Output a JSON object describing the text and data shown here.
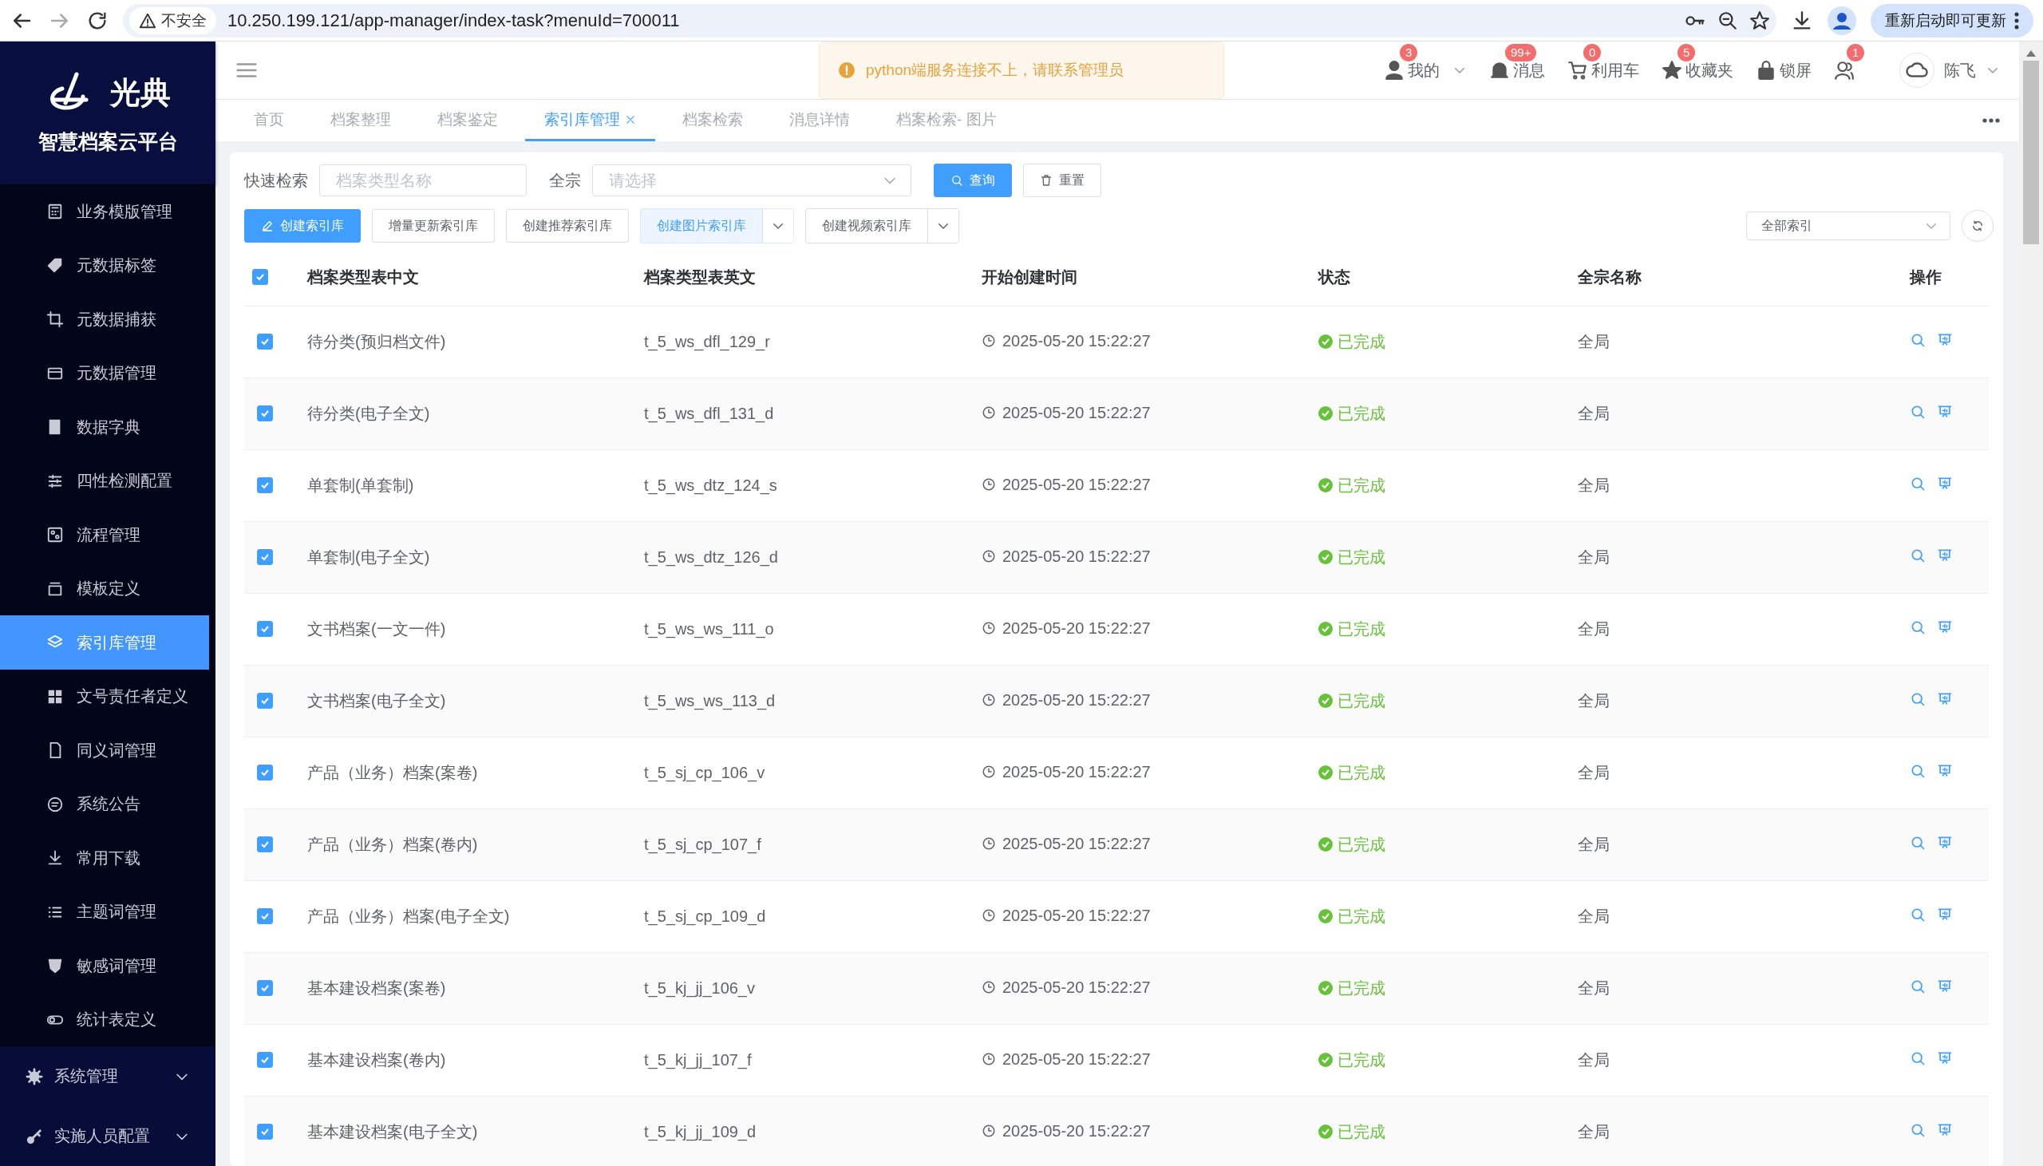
{
  "browser": {
    "security_label": "不安全",
    "url": "10.250.199.121/app-manager/index-task?menuId=700011",
    "update_button": "重新启动即可更新"
  },
  "sidebar": {
    "logo_text": "光典",
    "platform_name": "智慧档案云平台",
    "items": [
      {
        "label": "业务模版管理",
        "selected": false
      },
      {
        "label": "元数据标签",
        "selected": false
      },
      {
        "label": "元数据捕获",
        "selected": false
      },
      {
        "label": "元数据管理",
        "selected": false
      },
      {
        "label": "数据字典",
        "selected": false
      },
      {
        "label": "四性检测配置",
        "selected": false
      },
      {
        "label": "流程管理",
        "selected": false
      },
      {
        "label": "模板定义",
        "selected": false
      },
      {
        "label": "索引库管理",
        "selected": true
      },
      {
        "label": "文号责任者定义",
        "selected": false
      },
      {
        "label": "同义词管理",
        "selected": false
      },
      {
        "label": "系统公告",
        "selected": false
      },
      {
        "label": "常用下载",
        "selected": false
      },
      {
        "label": "主题词管理",
        "selected": false
      },
      {
        "label": "敏感词管理",
        "selected": false
      },
      {
        "label": "统计表定义",
        "selected": false
      }
    ],
    "groups": [
      {
        "label": "系统管理"
      },
      {
        "label": "实施人员配置"
      }
    ]
  },
  "header": {
    "items": [
      {
        "label": "我的",
        "badge": "3",
        "dropdown": true
      },
      {
        "label": "消息",
        "badge": "99+",
        "dropdown": false
      },
      {
        "label": "利用车",
        "badge": "0",
        "dropdown": false
      },
      {
        "label": "收藏夹",
        "badge": "5",
        "dropdown": false
      },
      {
        "label": "锁屏",
        "dropdown": false
      },
      {
        "badge": "1",
        "dropdown": false
      }
    ],
    "user": {
      "name": "陈飞"
    }
  },
  "toast": {
    "text": "python端服务连接不上，请联系管理员"
  },
  "tabs": [
    {
      "label": "首页",
      "selected": false
    },
    {
      "label": "档案整理",
      "selected": false
    },
    {
      "label": "档案鉴定",
      "selected": false
    },
    {
      "label": "索引库管理",
      "selected": true
    },
    {
      "label": "档案检索",
      "selected": false
    },
    {
      "label": "消息详情",
      "selected": false
    },
    {
      "label": "档案检索- 图片",
      "selected": false
    }
  ],
  "search": {
    "label": "快速检索",
    "placeholder": "档案类型名称",
    "fonds_label": "全宗",
    "fonds_placeholder": "请选择",
    "buttons": [
      {
        "label": "查询",
        "kind": "primary"
      },
      {
        "label": "重置",
        "kind": "default"
      }
    ]
  },
  "actions": [
    {
      "label": "创建索引库",
      "kind": "primary"
    },
    {
      "label": "增量更新索引库",
      "kind": "default"
    },
    {
      "label": "创建推荐索引库",
      "kind": "default"
    },
    {
      "label": "创建图片索引库",
      "kind": "split-active"
    },
    {
      "label": "创建视频索引库",
      "kind": "split"
    }
  ],
  "index_filter": {
    "value": "全部索引"
  },
  "table": {
    "all_checked": true,
    "columns": [
      "档案类型表中文",
      "档案类型表英文",
      "开始创建时间",
      "状态",
      "全宗名称",
      "操作"
    ],
    "rows": [
      {
        "checked": true,
        "name": "待分类(预归档文件)",
        "table": "t_5_ws_dfl_129_r",
        "created": "2025-05-20 15:22:27",
        "status": "已完成",
        "fonds": "全局"
      },
      {
        "checked": true,
        "name": "待分类(电子全文)",
        "table": "t_5_ws_dfl_131_d",
        "created": "2025-05-20 15:22:27",
        "status": "已完成",
        "fonds": "全局"
      },
      {
        "checked": true,
        "name": "单套制(单套制)",
        "table": "t_5_ws_dtz_124_s",
        "created": "2025-05-20 15:22:27",
        "status": "已完成",
        "fonds": "全局"
      },
      {
        "checked": true,
        "name": "单套制(电子全文)",
        "table": "t_5_ws_dtz_126_d",
        "created": "2025-05-20 15:22:27",
        "status": "已完成",
        "fonds": "全局"
      },
      {
        "checked": true,
        "name": "文书档案(一文一件)",
        "table": "t_5_ws_ws_111_o",
        "created": "2025-05-20 15:22:27",
        "status": "已完成",
        "fonds": "全局"
      },
      {
        "checked": true,
        "name": "文书档案(电子全文)",
        "table": "t_5_ws_ws_113_d",
        "created": "2025-05-20 15:22:27",
        "status": "已完成",
        "fonds": "全局"
      },
      {
        "checked": true,
        "name": "产品（业务）档案(案卷)",
        "table": "t_5_sj_cp_106_v",
        "created": "2025-05-20 15:22:27",
        "status": "已完成",
        "fonds": "全局"
      },
      {
        "checked": true,
        "name": "产品（业务）档案(卷内)",
        "table": "t_5_sj_cp_107_f",
        "created": "2025-05-20 15:22:27",
        "status": "已完成",
        "fonds": "全局"
      },
      {
        "checked": true,
        "name": "产品（业务）档案(电子全文)",
        "table": "t_5_sj_cp_109_d",
        "created": "2025-05-20 15:22:27",
        "status": "已完成",
        "fonds": "全局"
      },
      {
        "checked": true,
        "name": "基本建设档案(案卷)",
        "table": "t_5_kj_jj_106_v",
        "created": "2025-05-20 15:22:27",
        "status": "已完成",
        "fonds": "全局"
      },
      {
        "checked": true,
        "name": "基本建设档案(卷内)",
        "table": "t_5_kj_jj_107_f",
        "created": "2025-05-20 15:22:27",
        "status": "已完成",
        "fonds": "全局"
      },
      {
        "checked": true,
        "name": "基本建设档案(电子全文)",
        "table": "t_5_kj_jj_109_d",
        "created": "2025-05-20 15:22:27",
        "status": "已完成",
        "fonds": "全局"
      }
    ]
  }
}
